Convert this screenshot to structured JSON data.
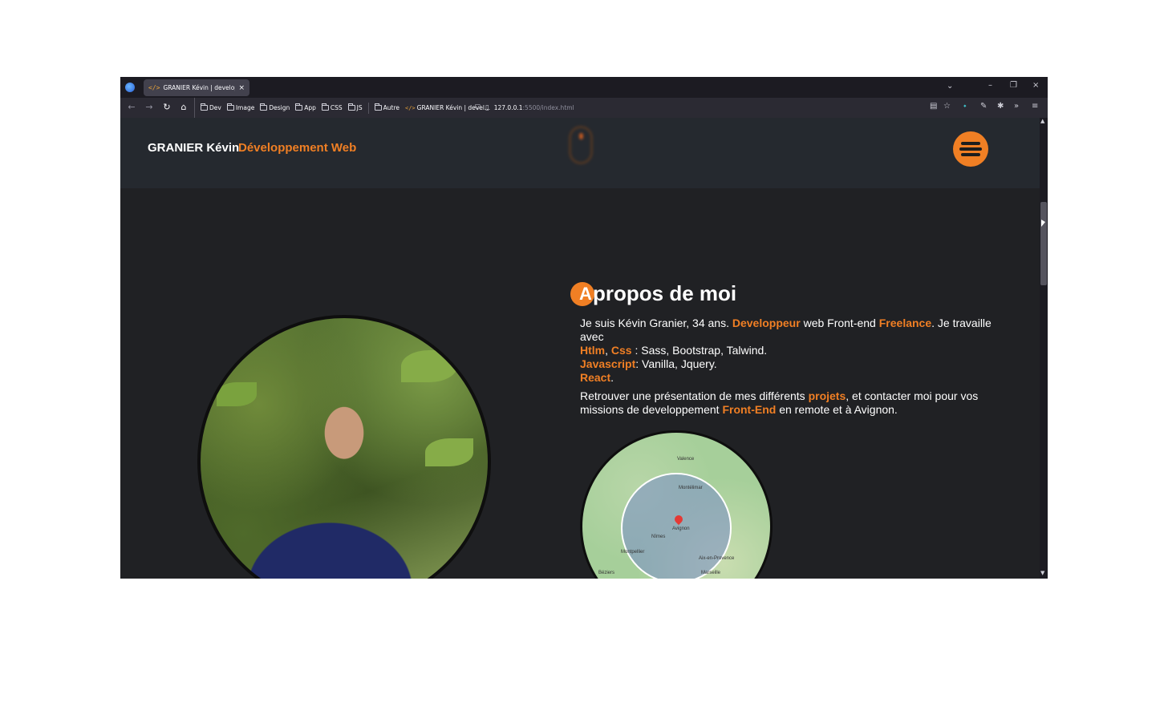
{
  "browser": {
    "tab": {
      "title": "GRANIER Kévin | developpeur w",
      "icon": "code-icon",
      "close": "×"
    },
    "tab_list_icon": "⌄",
    "window_controls": {
      "minimize": "–",
      "restore": "❐",
      "close": "×"
    },
    "nav": {
      "back": "←",
      "forward": "→",
      "reload": "↻",
      "home": "⌂"
    },
    "bookmarks": [
      {
        "label": "Dev",
        "icon": "folder-icon"
      },
      {
        "label": "Image",
        "icon": "folder-icon"
      },
      {
        "label": "Design",
        "icon": "folder-icon"
      },
      {
        "label": "App",
        "icon": "folder-icon"
      },
      {
        "label": "CSS",
        "icon": "folder-icon"
      },
      {
        "label": "JS",
        "icon": "folder-icon"
      },
      {
        "label": "Autre",
        "icon": "folder-icon"
      },
      {
        "label": "GRANIER Kévin | devel...",
        "icon": "code-icon"
      }
    ],
    "url": {
      "host": "127.0.0.1",
      "rest": ":5500/index.html"
    },
    "toolbar": {
      "reader": "▤",
      "star": "☆",
      "extension1": "⬩",
      "extension2": "✎",
      "extension3": "✱",
      "overflow": "»",
      "menu": "≡"
    }
  },
  "header": {
    "brand_name": "GRANIER Kévin",
    "brand_sub": "Développement Web"
  },
  "about": {
    "title_initial": "A",
    "title_rest": "propos de moi",
    "p1": {
      "t1": "Je suis Kévin Granier, 34 ans. ",
      "h1": "Developpeur",
      "t2": " web Front-end ",
      "h2": "Freelance",
      "t3": ". Je travaille avec",
      "h3": "Htlm",
      "t4": ", ",
      "h4": "Css",
      "t5": " : Sass, Bootstrap, Talwind.",
      "h5": "Javascript",
      "t6": ": Vanilla, Jquery.",
      "h6": "React",
      "t7": "."
    },
    "p2": {
      "t1": "Retrouver une présentation de mes différents ",
      "h1": "projets",
      "t2": ", et contacter moi pour vos missions de developpement ",
      "h2": "Front-End",
      "t3": " en remote et à Avignon."
    },
    "map_labels": [
      "Valence",
      "Montélimar",
      "Avignon",
      "Nîmes",
      "Montpellier",
      "Aix-en-Provence",
      "Marseille",
      "Béziers"
    ]
  },
  "colors": {
    "accent": "#f07f24",
    "page_bg": "#202124",
    "header_bg": "#25292f"
  }
}
